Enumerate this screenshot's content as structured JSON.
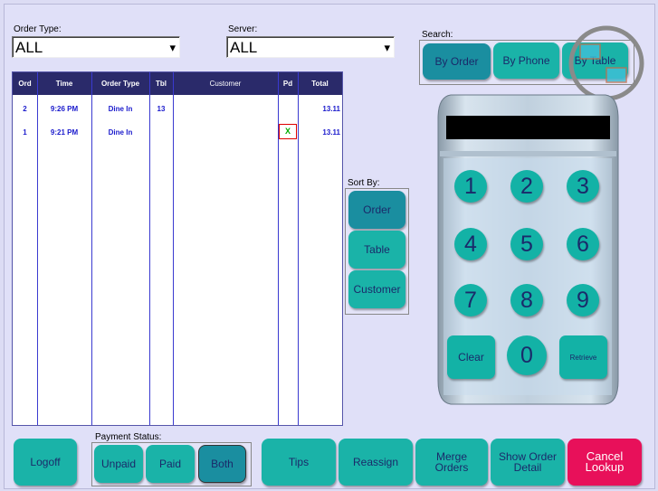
{
  "filters": {
    "order_type_label": "Order Type:",
    "order_type_value": "ALL",
    "server_label": "Server:",
    "server_value": "ALL"
  },
  "search": {
    "label": "Search:",
    "by_order": "By Order",
    "by_phone": "By Phone",
    "by_table": "By Table"
  },
  "table": {
    "headers": [
      "Ord",
      "Time",
      "Order Type",
      "Tbl",
      "Customer",
      "Pd",
      "Total"
    ],
    "rows": [
      {
        "ord": "2",
        "time": "9:26 PM",
        "type": "Dine In",
        "tbl": "13",
        "customer": "",
        "pd": "",
        "total": "13.11"
      },
      {
        "ord": "1",
        "time": "9:21 PM",
        "type": "Dine In",
        "tbl": "",
        "customer": "",
        "pd": "X",
        "total": "13.11"
      }
    ]
  },
  "sort": {
    "label": "Sort By:",
    "order": "Order",
    "table": "Table",
    "customer": "Customer"
  },
  "keypad": {
    "display": "",
    "keys": [
      "1",
      "2",
      "3",
      "4",
      "5",
      "6",
      "7",
      "8",
      "9",
      "Clear",
      "0",
      "Retrieve"
    ]
  },
  "bottom": {
    "logoff": "Logoff",
    "payment_status_label": "Payment Status:",
    "unpaid": "Unpaid",
    "paid": "Paid",
    "both": "Both",
    "tips": "Tips",
    "reassign": "Reassign",
    "merge_orders": "Merge Orders",
    "show_order_detail": "Show Order Detail",
    "cancel_lookup": "Cancel Lookup"
  },
  "colors": {
    "teal": "#1ab3a8",
    "teal_selected": "#1a8ea0",
    "header_navy": "#2a2a6a",
    "cancel_red": "#e8105a"
  }
}
